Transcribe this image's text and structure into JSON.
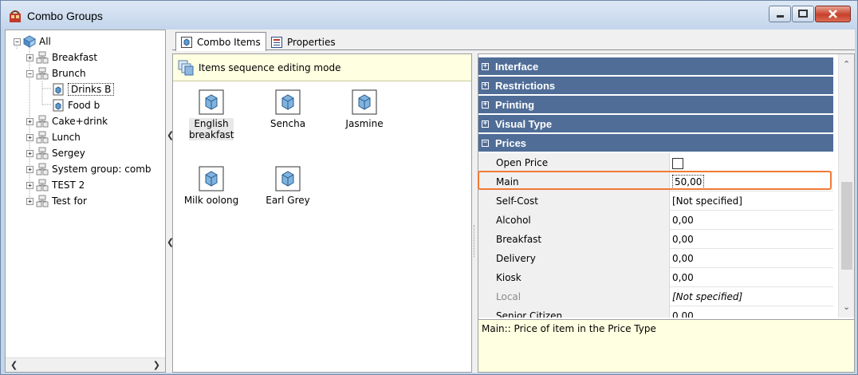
{
  "window": {
    "title": "Combo Groups"
  },
  "tree": {
    "items": [
      {
        "label": "All"
      },
      {
        "label": "Breakfast"
      },
      {
        "label": "Brunch"
      },
      {
        "label": "Drinks B"
      },
      {
        "label": "Food b"
      },
      {
        "label": "Cake+drink"
      },
      {
        "label": "Lunch"
      },
      {
        "label": "Sergey"
      },
      {
        "label": "System group: comb"
      },
      {
        "label": "TEST 2"
      },
      {
        "label": "Test for"
      }
    ]
  },
  "tabs": [
    {
      "label": "Combo Items",
      "active": true
    },
    {
      "label": "Properties",
      "active": false
    }
  ],
  "items_panel": {
    "mode_label": "Items sequence editing mode",
    "items": [
      {
        "label": "English breakfast"
      },
      {
        "label": "Sencha"
      },
      {
        "label": "Jasmine"
      },
      {
        "label": "Milk oolong"
      },
      {
        "label": "Earl Grey"
      }
    ]
  },
  "property_grid": {
    "categories": [
      {
        "label": "Interface",
        "expanded": false
      },
      {
        "label": "Restrictions",
        "expanded": false
      },
      {
        "label": "Printing",
        "expanded": false
      },
      {
        "label": "Visual Type",
        "expanded": false
      },
      {
        "label": "Prices",
        "expanded": true
      }
    ],
    "rows": [
      {
        "name": "Open Price",
        "value": ""
      },
      {
        "name": "Main",
        "value": "50,00"
      },
      {
        "name": "Self-Cost",
        "value": "[Not specified]"
      },
      {
        "name": "Alcohol",
        "value": "0,00"
      },
      {
        "name": "Breakfast",
        "value": "0,00"
      },
      {
        "name": "Delivery",
        "value": "0,00"
      },
      {
        "name": "Kiosk",
        "value": "0,00"
      },
      {
        "name": "Local",
        "value": "[Not specified]"
      },
      {
        "name": "Senior Citizen",
        "value": "0,00"
      }
    ],
    "description": "Main:: Price of item in the Price Type"
  },
  "colors": {
    "category_bg": "#4f6d97",
    "highlight": "#f07a35",
    "info_bg": "#ffffe1"
  }
}
